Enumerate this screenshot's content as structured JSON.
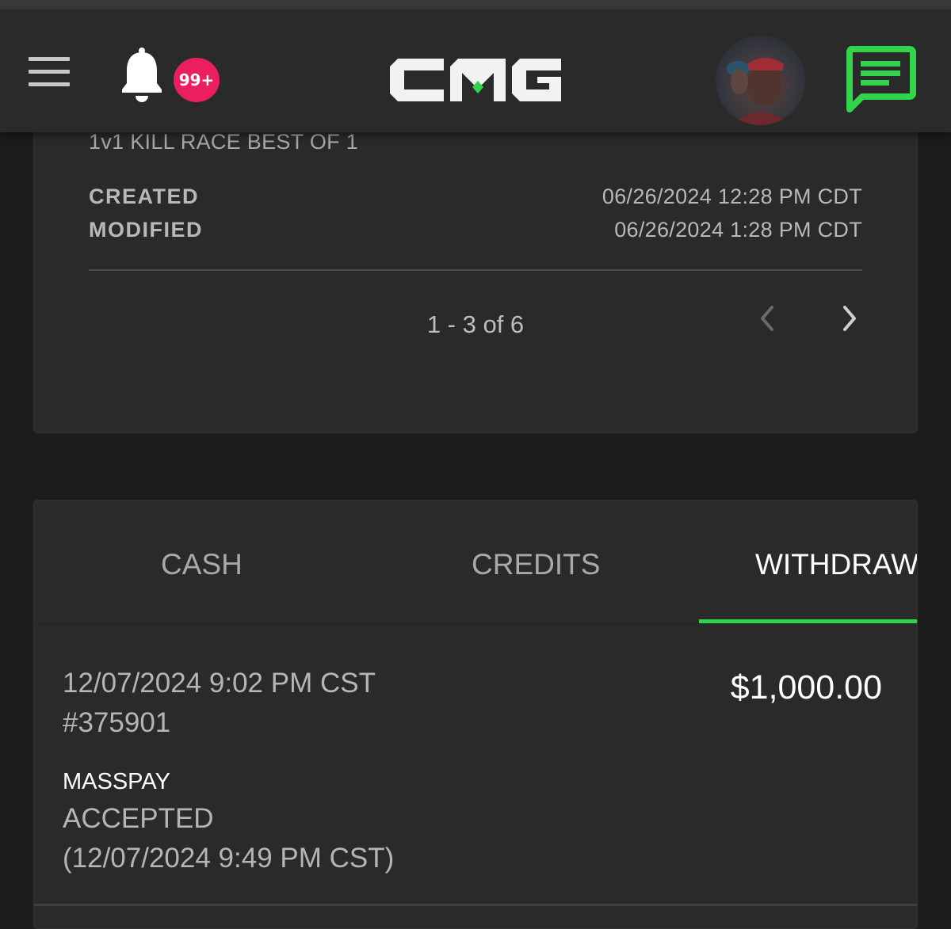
{
  "header": {
    "notification_count": "99+",
    "brand": "CMG",
    "accent_color": "#31d44a",
    "badge_color": "#ec1f5e",
    "icons": [
      "menu-icon",
      "bell-icon",
      "chat-icon"
    ]
  },
  "match_card": {
    "mode": "1v1 KILL RACE BEST OF 1",
    "created_label": "CREATED",
    "created_value": "06/26/2024 12:28 PM CDT",
    "modified_label": "MODIFIED",
    "modified_value": "06/26/2024 1:28 PM CDT",
    "pagination": "1 - 3 of 6"
  },
  "wallet": {
    "tabs": [
      {
        "label": "CASH",
        "active": false
      },
      {
        "label": "CREDITS",
        "active": false
      },
      {
        "label": "WITHDRAW",
        "active": true
      }
    ],
    "transaction": {
      "date": "12/07/2024 9:02 PM CST",
      "id": "#375901",
      "amount": "$1,000.00",
      "method": "MASSPAY",
      "status": "ACCEPTED",
      "status_time": "(12/07/2024 9:49 PM CST)"
    }
  }
}
